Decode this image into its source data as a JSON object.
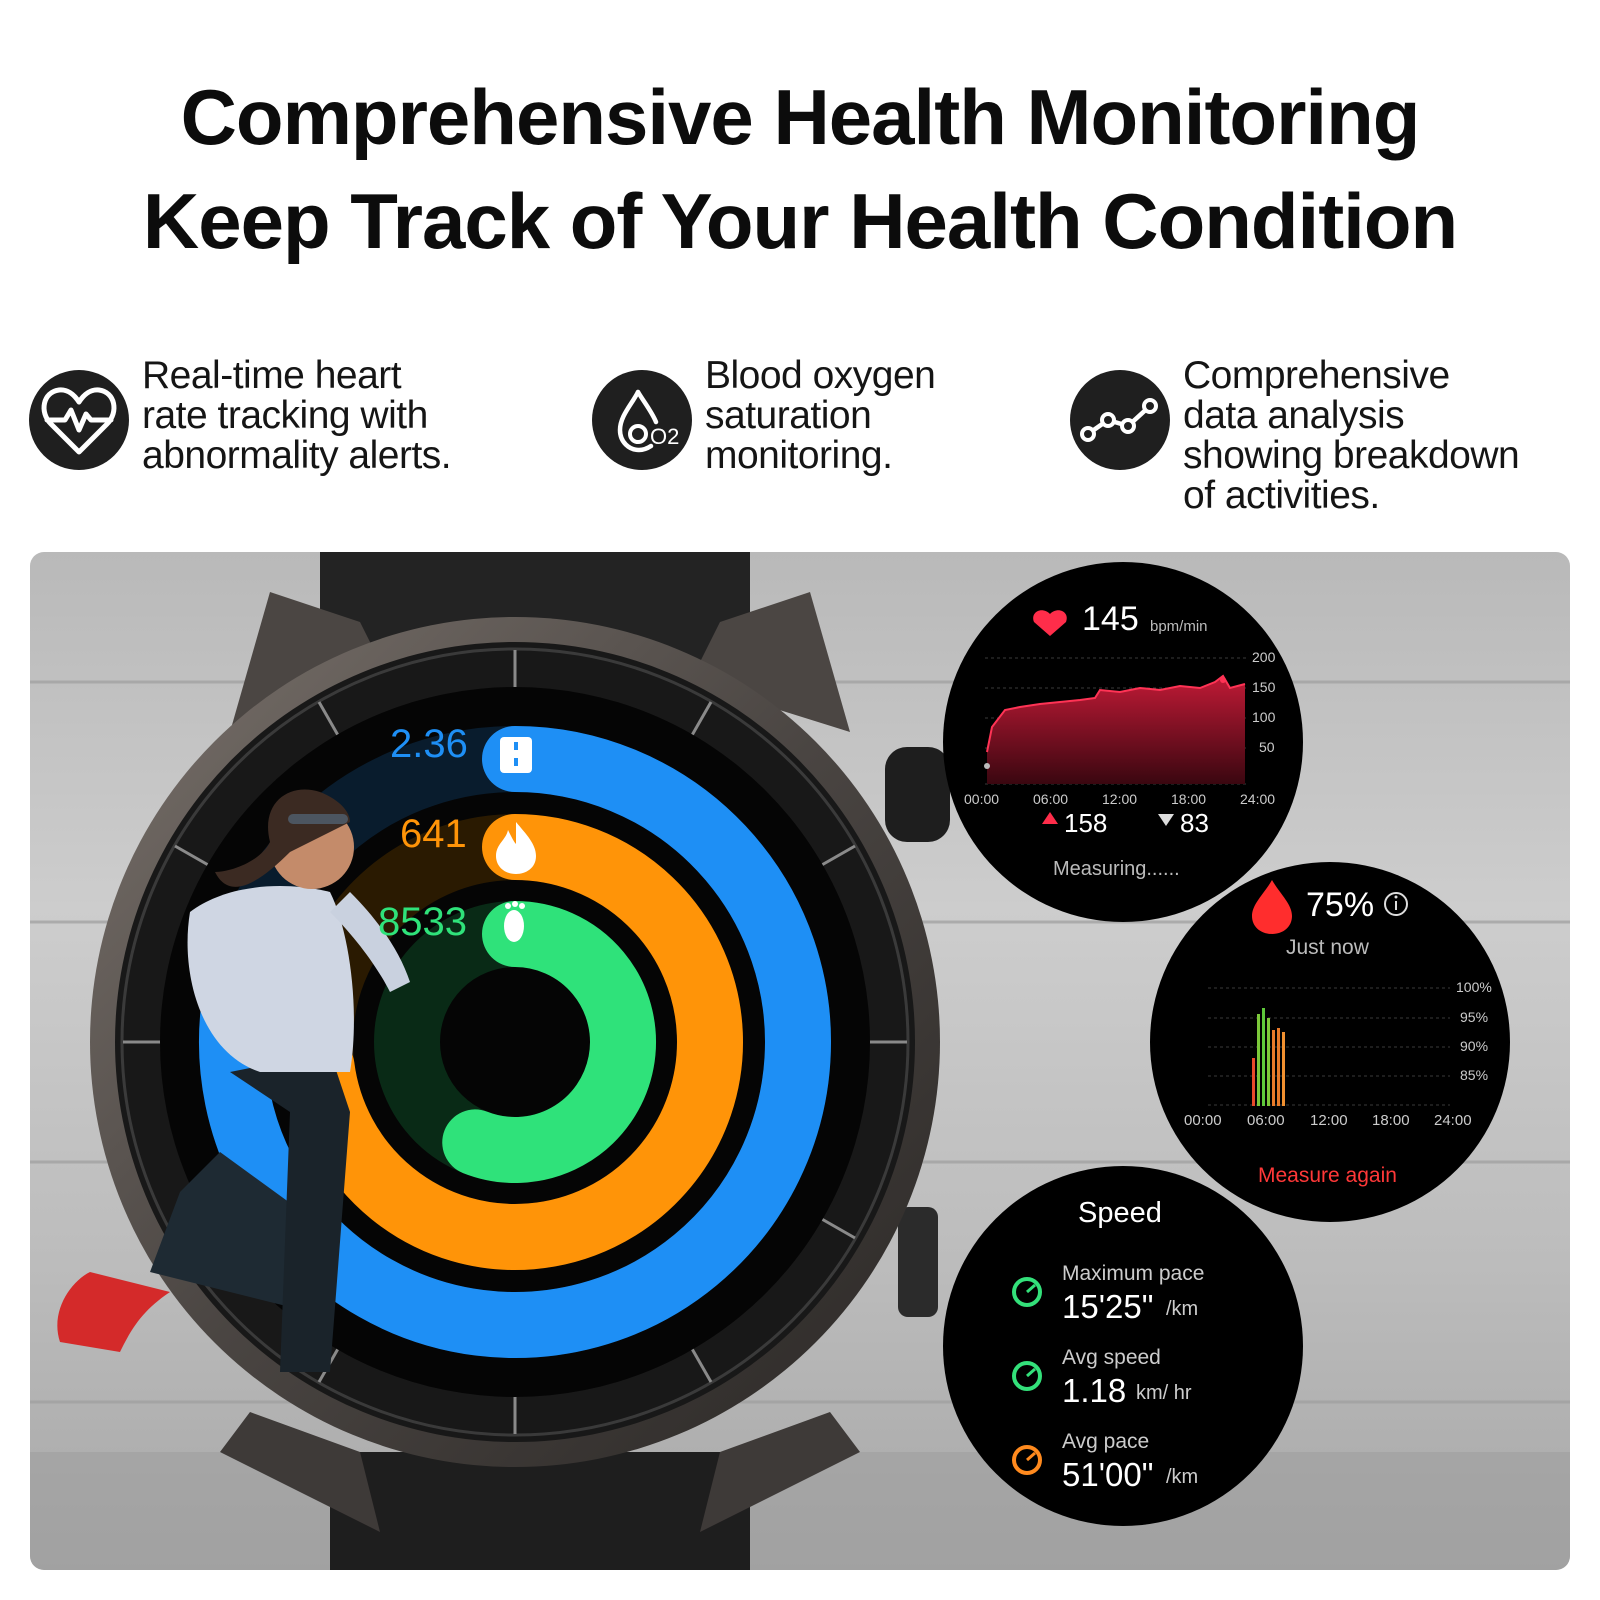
{
  "headline": {
    "line1": "Comprehensive Health Monitoring",
    "line2": "Keep Track of Your Health Condition"
  },
  "features": [
    {
      "icon": "heart-pulse-icon",
      "lines": [
        "Real-time heart",
        "rate tracking with",
        "abnormality alerts."
      ]
    },
    {
      "icon": "blood-oxygen-drop-icon",
      "icon_text": "O2",
      "lines": [
        "Blood oxygen",
        "saturation",
        "monitoring."
      ]
    },
    {
      "icon": "trend-line-icon",
      "lines": [
        "Comprehensive",
        "data analysis",
        "showing breakdown",
        "of activities."
      ]
    }
  ],
  "watch_face": {
    "rings": [
      {
        "value": "2.36",
        "icon": "road-icon",
        "color": "#1e8ff5",
        "progress": 0.78
      },
      {
        "value": "641",
        "icon": "flame-icon",
        "color": "#ff9408",
        "progress": 0.73
      },
      {
        "value": "8533",
        "icon": "footprint-icon",
        "color": "#2fe27a",
        "progress": 0.56
      }
    ]
  },
  "heart_rate_panel": {
    "value": "145",
    "unit": "bpm/min",
    "y_ticks": [
      "200",
      "150",
      "100",
      "50"
    ],
    "x_ticks": [
      "00:00",
      "06:00",
      "12:00",
      "18:00",
      "24:00"
    ],
    "max": "158",
    "min": "83",
    "status": "Measuring......",
    "colors": {
      "heart": "#ff2d4a",
      "area": "#a5142c"
    }
  },
  "spo2_panel": {
    "value": "75%",
    "time": "Just now",
    "y_ticks": [
      "100%",
      "95%",
      "90%",
      "85%"
    ],
    "x_ticks": [
      "00:00",
      "06:00",
      "12:00",
      "18:00",
      "24:00"
    ],
    "action": "Measure again",
    "colors": {
      "drop": "#ff2d2d",
      "action": "#ff3838"
    }
  },
  "speed_panel": {
    "title": "Speed",
    "rows": [
      {
        "label": "Maximum pace",
        "value": "15'25\"",
        "unit": "/km",
        "icon": "speedometer-icon",
        "icon_color": "#33e07a"
      },
      {
        "label": "Avg speed",
        "value": "1.18",
        "unit": "km/ hr",
        "icon": "speedometer-icon",
        "icon_color": "#33e07a"
      },
      {
        "label": "Avg pace",
        "value": "51'00\"",
        "unit": "/km",
        "icon": "speedometer-icon",
        "icon_color": "#ff8a1e"
      }
    ]
  }
}
